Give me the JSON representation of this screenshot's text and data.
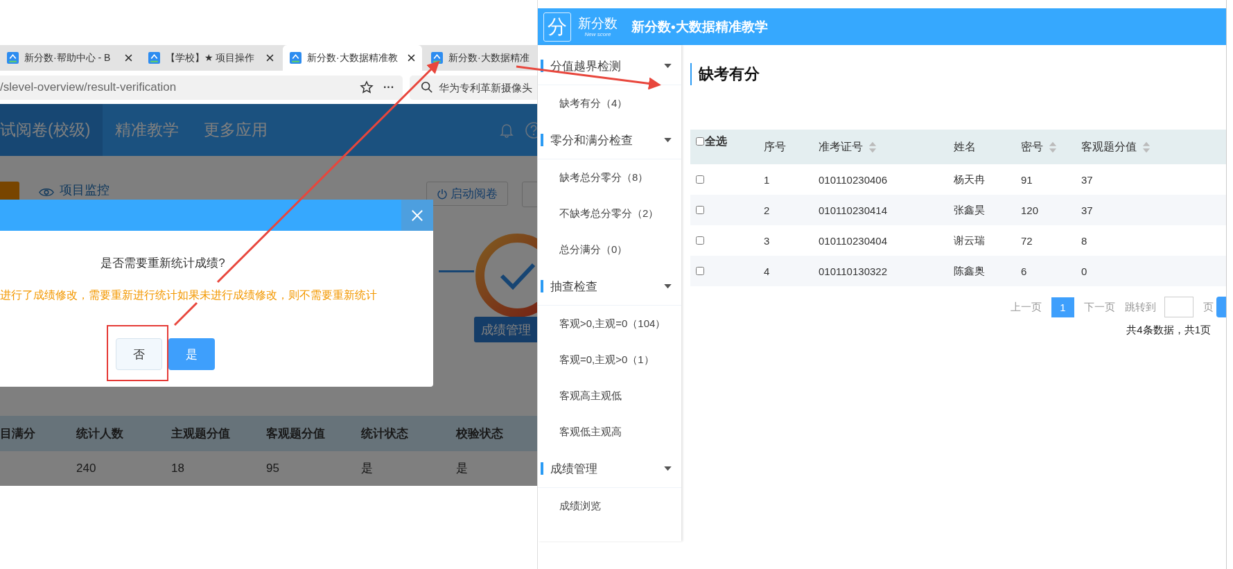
{
  "browser": {
    "tabs": [
      {
        "label": "新分数·帮助中心 - B",
        "selected": false
      },
      {
        "label": "【学校】★ 项目操作",
        "selected": false
      },
      {
        "label": "新分数·大数据精准教",
        "selected": true
      },
      {
        "label": "新分数·大数据精准",
        "selected": false
      }
    ],
    "address": "/slevel-overview/result-verification",
    "more": "···",
    "search": {
      "placeholder": "华为专利革新摄像头"
    }
  },
  "app_nav": [
    {
      "label": "试阅卷(校级)",
      "selected": true
    },
    {
      "label": "精准教学",
      "selected": false
    },
    {
      "label": "更多应用",
      "selected": false
    }
  ],
  "toolbar": {
    "monitor": "项目监控",
    "start_button": "启动阅卷"
  },
  "steps": {
    "button": "成绩管理"
  },
  "summary_table": {
    "columns": [
      "目满分",
      "统计人数",
      "主观题分值",
      "客观题分值",
      "统计状态",
      "校验状态"
    ],
    "rows": [
      {
        "cells": [
          "",
          "240",
          "18",
          "95",
          "是",
          "是"
        ]
      }
    ]
  },
  "dialog": {
    "question": "是否需要重新统计成绩?",
    "note": "进行了成绩修改，需要重新进行统计如果未进行成绩修改，则不需要重新统计",
    "buttons": [
      {
        "label": "否",
        "kind": "secondary",
        "highlighted": true
      },
      {
        "label": "是",
        "kind": "primary",
        "highlighted": false
      }
    ]
  },
  "app": {
    "logo_mark": "分",
    "logo_name": "新分数",
    "logo_sub": "New score",
    "title": "新分数•大数据精准教学"
  },
  "sidebar": [
    {
      "label": "分值越界检测",
      "expanded": true,
      "children": [
        {
          "label": "缺考有分（4）"
        }
      ]
    },
    {
      "label": "零分和满分检查",
      "expanded": true,
      "children": [
        {
          "label": "缺考总分零分（8）"
        },
        {
          "label": "不缺考总分零分（2）"
        },
        {
          "label": "总分满分（0）"
        }
      ]
    },
    {
      "label": "抽查检查",
      "expanded": true,
      "children": [
        {
          "label": "客观>0,主观=0（104）"
        },
        {
          "label": "客观=0,主观>0（1）"
        },
        {
          "label": "客观高主观低"
        },
        {
          "label": "客观低主观高"
        }
      ]
    },
    {
      "label": "成绩管理",
      "expanded": true,
      "children": [
        {
          "label": "成绩浏览"
        }
      ]
    }
  ],
  "page_title": "缺考有分",
  "table": {
    "select_all": {
      "label": "全选",
      "checked": false
    },
    "columns": [
      {
        "label": "序号",
        "sortable": false
      },
      {
        "label": "准考证号",
        "sortable": true
      },
      {
        "label": "姓名",
        "sortable": false
      },
      {
        "label": "密号",
        "sortable": true
      },
      {
        "label": "客观题分值",
        "sortable": true
      }
    ],
    "rows": [
      {
        "checked": false,
        "cells": [
          "1",
          "010110230406",
          "杨天冉",
          "91",
          "37"
        ]
      },
      {
        "checked": false,
        "cells": [
          "2",
          "010110230414",
          "张鑫昊",
          "120",
          "37"
        ]
      },
      {
        "checked": false,
        "cells": [
          "3",
          "010110230404",
          "谢云瑞",
          "72",
          "8"
        ]
      },
      {
        "checked": false,
        "cells": [
          "4",
          "010110130322",
          "陈鑫奥",
          "6",
          "0"
        ]
      }
    ]
  },
  "pagination": {
    "prev": "上一页",
    "pages": [
      {
        "label": "1",
        "selected": true
      }
    ],
    "next": "下一页",
    "jump_label": "跳转到",
    "unit": "页",
    "summary": "共4条数据，共1页"
  }
}
